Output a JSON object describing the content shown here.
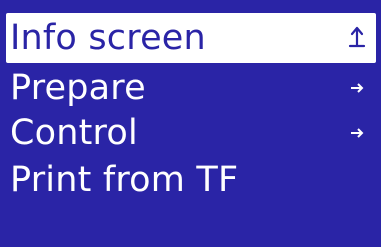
{
  "menu": {
    "items": [
      {
        "label": "Info screen",
        "icon": "back-arrow-icon",
        "selected": true
      },
      {
        "label": "Prepare",
        "icon": "right-arrow-icon",
        "selected": false
      },
      {
        "label": "Control",
        "icon": "right-arrow-icon",
        "selected": false
      },
      {
        "label": "Print from TF",
        "icon": "",
        "selected": false
      }
    ]
  },
  "colors": {
    "background": "#2a24a6",
    "text": "#ffffff",
    "highlight": "#ffffff",
    "highlight_text": "#2a24a6"
  }
}
